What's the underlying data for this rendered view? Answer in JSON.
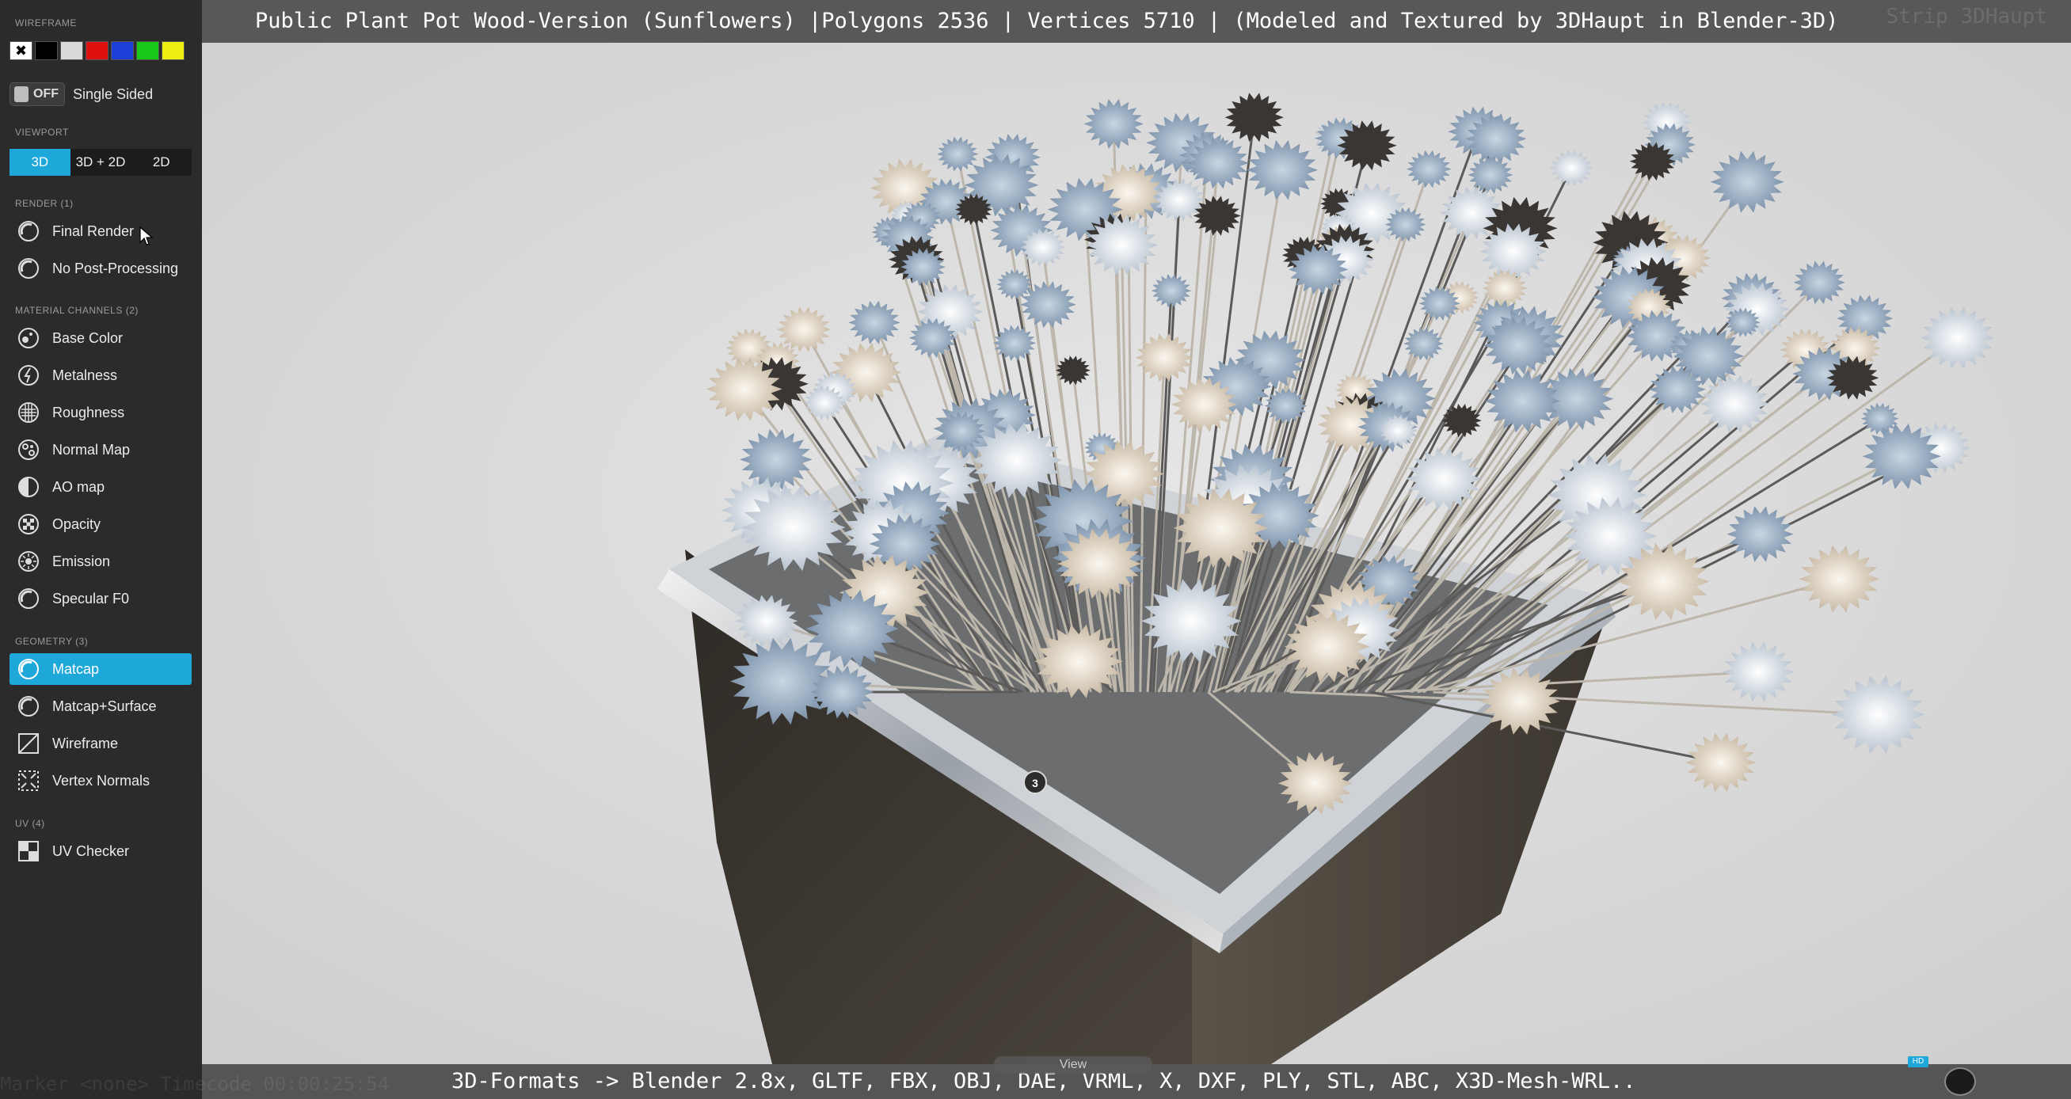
{
  "title_bar": {
    "title": "Public Plant Pot Wood-Version (Sunflowers) |Polygons 2536 | Vertices 5710 | (Modeled and Textured by 3DHaupt in Blender-3D)",
    "ghost_text": "Strip 3DHaupt"
  },
  "bottom_bar": {
    "formats": "3D-Formats -> Blender 2.8x, GLTF, FBX, OBJ, DAE, VRML, X, DXF, PLY, STL, ABC, X3D-Mesh-WRL..",
    "view_tab": "View",
    "hd_badge": "HD",
    "ghost_text": "Marker <none>  Timecode 00:00:25:54"
  },
  "sidebar": {
    "wireframe_label": "WIREFRAME",
    "swatches": [
      {
        "color": "#ffffff",
        "icon": "close-icon",
        "selected": true
      },
      {
        "color": "#000000"
      },
      {
        "color": "#d9d9d9"
      },
      {
        "color": "#e01010"
      },
      {
        "color": "#1e3fd8"
      },
      {
        "color": "#18c818"
      },
      {
        "color": "#eeee10"
      }
    ],
    "single_sided": {
      "toggle_text": "OFF",
      "label": "Single Sided"
    },
    "viewport": {
      "label": "VIEWPORT",
      "options": [
        "3D",
        "3D + 2D",
        "2D"
      ],
      "active": "3D"
    },
    "render": {
      "label": "RENDER (1)",
      "items": [
        {
          "label": "Final Render",
          "icon": "render-icon"
        },
        {
          "label": "No Post-Processing",
          "icon": "render-icon"
        }
      ]
    },
    "material_channels": {
      "label": "MATERIAL CHANNELS (2)",
      "items": [
        {
          "label": "Base Color",
          "icon": "base-color-icon"
        },
        {
          "label": "Metalness",
          "icon": "metalness-icon"
        },
        {
          "label": "Roughness",
          "icon": "roughness-icon"
        },
        {
          "label": "Normal Map",
          "icon": "normal-map-icon"
        },
        {
          "label": "AO map",
          "icon": "ao-map-icon"
        },
        {
          "label": "Opacity",
          "icon": "opacity-icon"
        },
        {
          "label": "Emission",
          "icon": "emission-icon"
        },
        {
          "label": "Specular F0",
          "icon": "specular-icon"
        }
      ]
    },
    "geometry": {
      "label": "GEOMETRY (3)",
      "items": [
        {
          "label": "Matcap",
          "icon": "matcap-icon",
          "active": true
        },
        {
          "label": "Matcap+Surface",
          "icon": "matcap-surface-icon"
        },
        {
          "label": "Wireframe",
          "icon": "wireframe-icon"
        },
        {
          "label": "Vertex Normals",
          "icon": "vertex-normals-icon"
        }
      ]
    },
    "uv": {
      "label": "UV (4)",
      "items": [
        {
          "label": "UV Checker",
          "icon": "uv-checker-icon"
        }
      ]
    }
  },
  "viewport_scene": {
    "hotspot_label": "3",
    "background": "#dcdcdc",
    "accent": "#1ea7d9"
  }
}
